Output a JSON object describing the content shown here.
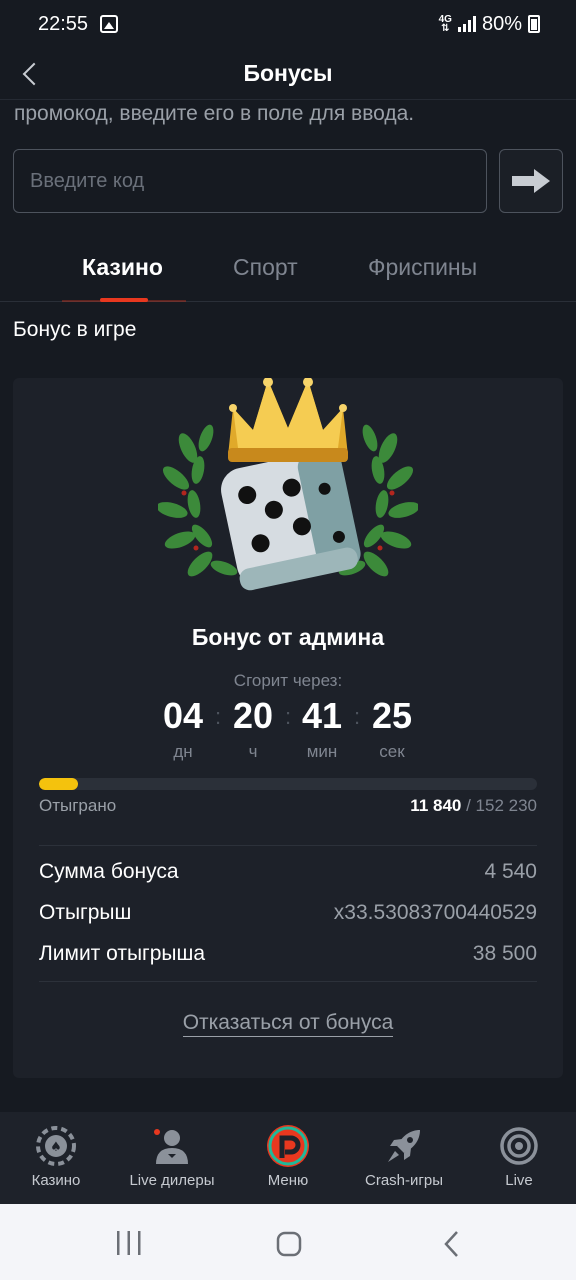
{
  "status_bar": {
    "time": "22:55",
    "network": "4G",
    "battery": "80%"
  },
  "header": {
    "title": "Бонусы"
  },
  "promo": {
    "hint_text": "промокод, введите его в поле для ввода.",
    "placeholder": "Введите код"
  },
  "tabs": [
    {
      "label": "Казино",
      "active": true
    },
    {
      "label": "Спорт",
      "active": false
    },
    {
      "label": "Фриспины",
      "active": false
    }
  ],
  "section_title": "Бонус в игре",
  "bonus": {
    "name": "Бонус от админа",
    "expires_label": "Сгорит через:",
    "timer": [
      {
        "value": "04",
        "unit": "дн"
      },
      {
        "value": "20",
        "unit": "ч"
      },
      {
        "value": "41",
        "unit": "мин"
      },
      {
        "value": "25",
        "unit": "сек"
      }
    ],
    "progress_fraction": 0.078,
    "played_label": "Отыграно",
    "played_current": "11 840",
    "played_total": "/ 152 230",
    "rows": [
      {
        "label": "Сумма бонуса",
        "value": "4 540"
      },
      {
        "label": "Отыгрыш",
        "value": "x33.53083700440529"
      },
      {
        "label": "Лимит отыгрыша",
        "value": "38 500"
      }
    ],
    "decline_label": "Отказаться от бонуса"
  },
  "bottom_nav": [
    {
      "label": "Казино",
      "icon": "casino-chip-icon"
    },
    {
      "label": "Live дилеры",
      "icon": "dealer-icon"
    },
    {
      "label": "Меню",
      "icon": "menu-logo-icon"
    },
    {
      "label": "Crash-игры",
      "icon": "rocket-icon"
    },
    {
      "label": "Live",
      "icon": "live-target-icon"
    }
  ],
  "colors": {
    "accent": "#e8381f",
    "progress": "#f4c20d",
    "background": "#161a21",
    "card": "#1d2129"
  }
}
